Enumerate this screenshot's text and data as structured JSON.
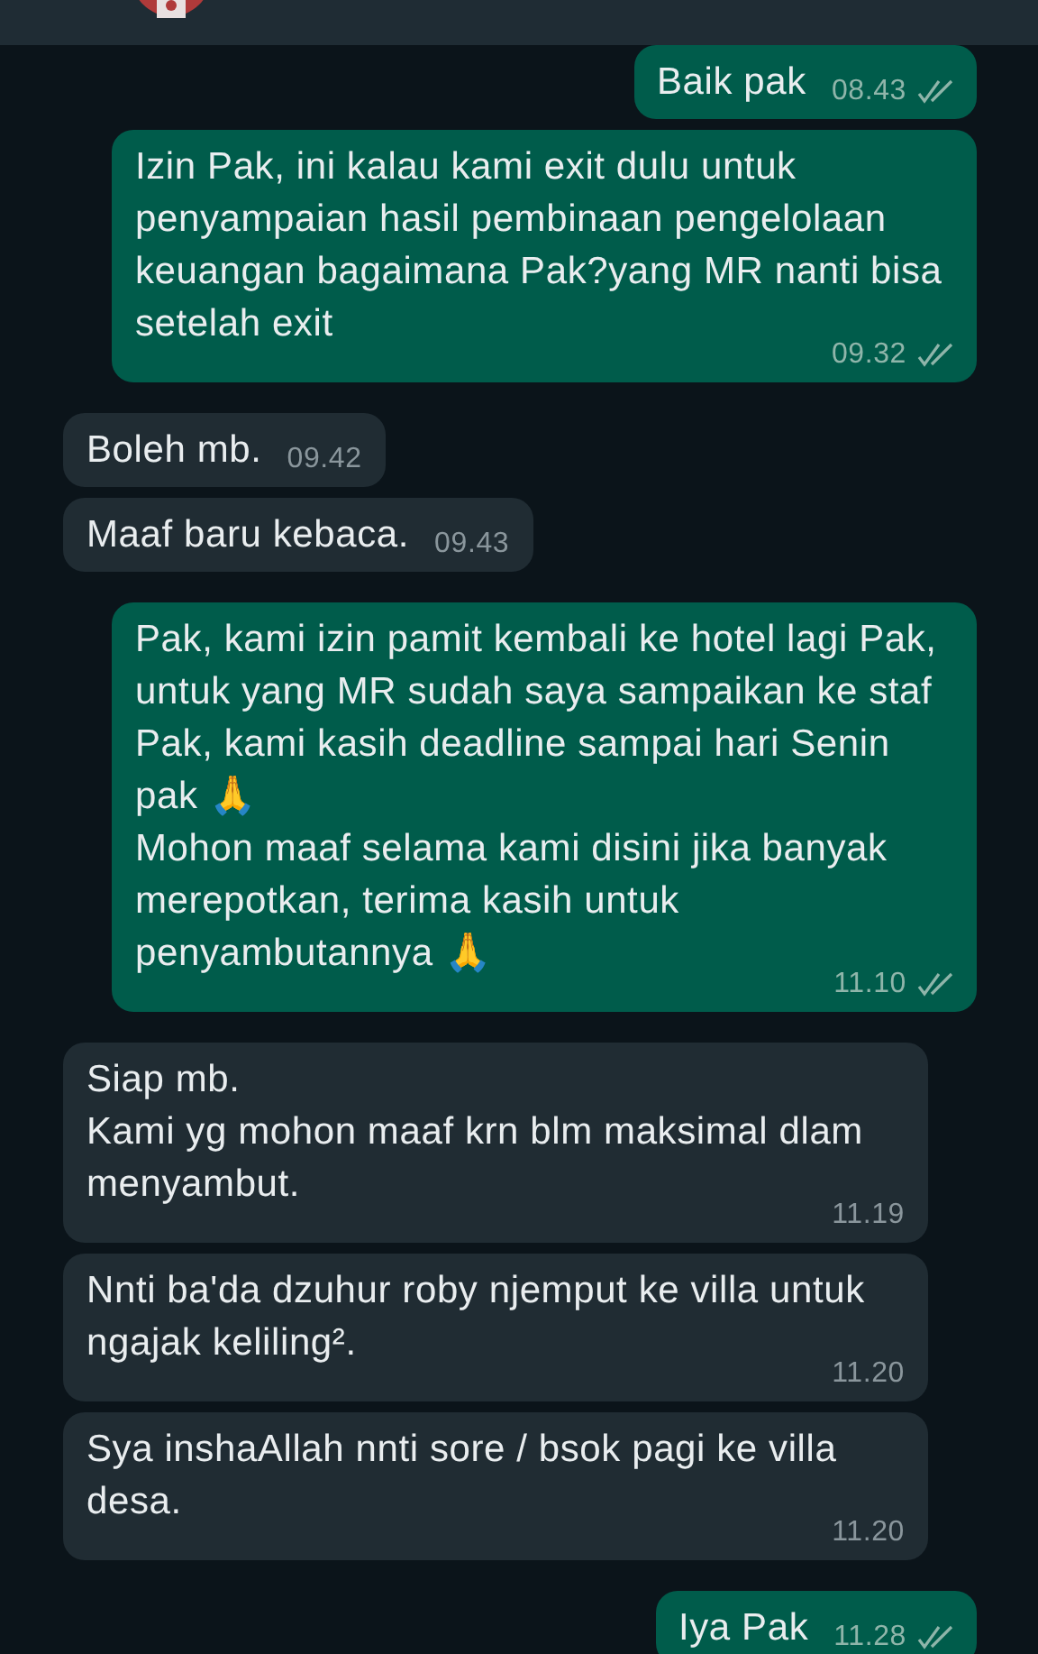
{
  "messages": [
    {
      "kind": "outgoing",
      "text": "Baik pak",
      "time": "08.43",
      "read": false
    },
    {
      "kind": "outgoing",
      "text": "Izin Pak, ini kalau kami exit dulu untuk penyampaian hasil pembinaan pengelolaan keuangan bagaimana Pak?yang MR nanti bisa setelah exit",
      "time": "09.32",
      "read": false
    },
    {
      "kind": "incoming",
      "text": "Boleh mb.",
      "time": "09.42"
    },
    {
      "kind": "incoming",
      "text": "Maaf baru kebaca.",
      "time": "09.43"
    },
    {
      "kind": "outgoing",
      "text": "Pak, kami izin pamit kembali ke hotel lagi Pak, untuk yang MR sudah saya sampaikan ke staf Pak, kami kasih deadline sampai hari Senin pak 🙏\nMohon maaf selama kami disini jika banyak merepotkan, terima kasih untuk penyambutannya 🙏",
      "time": "11.10",
      "read": false
    },
    {
      "kind": "incoming",
      "text": "Siap mb.\nKami yg mohon maaf krn blm maksimal dlam menyambut.",
      "time": "11.19"
    },
    {
      "kind": "incoming",
      "text": "Nnti ba'da dzuhur roby njemput ke villa untuk ngajak keliling².",
      "time": "11.20"
    },
    {
      "kind": "incoming",
      "text": "Sya inshaAllah nnti sore / bsok pagi ke villa desa.",
      "time": "11.20"
    },
    {
      "kind": "outgoing",
      "text": "Iya Pak",
      "time": "11.28",
      "read": false
    }
  ]
}
